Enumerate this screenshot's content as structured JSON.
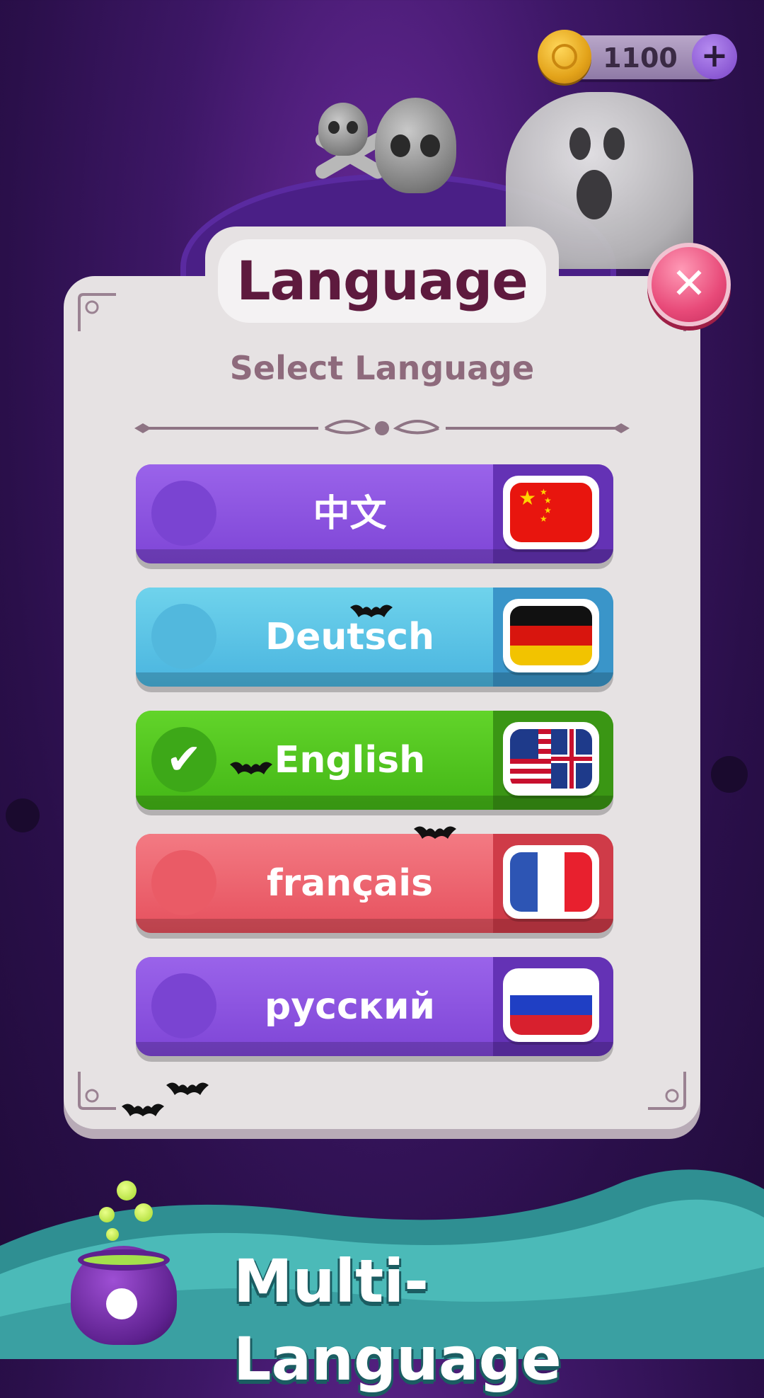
{
  "coins": {
    "count": "1100",
    "icon": "coin-icon",
    "add_icon": "plus-icon"
  },
  "dialog": {
    "title": "Language",
    "subtitle": "Select Language",
    "close_icon": "close-icon"
  },
  "languages": [
    {
      "label": "中文",
      "selected": false,
      "color": "#8a4fe0",
      "flag": "china-flag-icon"
    },
    {
      "label": "Deutsch",
      "selected": false,
      "color": "#5bc4e4",
      "flag": "germany-flag-icon"
    },
    {
      "label": "English",
      "selected": true,
      "color": "#4cc422",
      "flag": "usa-uk-flag-icon"
    },
    {
      "label": "français",
      "selected": false,
      "color": "#ec5f6c",
      "flag": "france-flag-icon"
    },
    {
      "label": "русский",
      "selected": false,
      "color": "#8a4fe0",
      "flag": "russia-flag-icon"
    }
  ],
  "footer": {
    "text": "Multi-Language"
  },
  "colors": {
    "title": "#5e1a3e",
    "subtitle": "#8e6a7c",
    "panel": "#e6e2e3",
    "close": "#e84a79",
    "teal_wave": "#49b7b6"
  }
}
